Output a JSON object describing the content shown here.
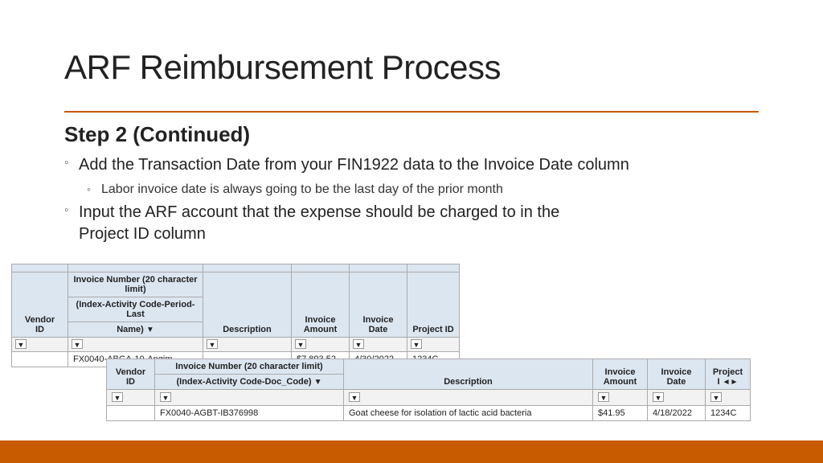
{
  "slide": {
    "title": "ARF Reimbursement Process",
    "step_heading": "Step 2 (Continued)",
    "bullets": [
      {
        "text": "Add the Transaction Date from your FIN1922 data to the Invoice Date column",
        "sub_bullets": [
          "Labor invoice date is always going to be the last day of the prior month"
        ]
      },
      {
        "text": "Input the ARF account that the expense should be charged to in the Project ID column",
        "sub_bullets": []
      }
    ]
  },
  "table1": {
    "headers": {
      "vendor_id": "Vendor ID",
      "invoice_number_line1": "Invoice Number (20 character",
      "invoice_number_line2": "limit)",
      "invoice_number_line3": "(Index-Activity Code-Period-Last",
      "invoice_number_line4": "Name)",
      "description": "Description",
      "invoice_amount": "Invoice Amount",
      "invoice_date": "Invoice Date",
      "project_id": "Project ID"
    },
    "row": {
      "vendor_id": "",
      "invoice_number": "FX0040-ABGA-10-Angim",
      "description": "",
      "invoice_amount": "$7,893.52",
      "invoice_date": "4/30/2022",
      "project_id": "1234C"
    }
  },
  "table2": {
    "headers": {
      "vendor_id": "Vendor ID",
      "invoice_number_line1": "Invoice Number (20 character limit)",
      "invoice_number_line2": "(Index-Activity Code-Doc_Code)",
      "description": "Description",
      "invoice_amount": "Invoice Amount",
      "invoice_date": "Invoice Date",
      "project_id": "Project I..."
    },
    "row": {
      "vendor_id": "",
      "invoice_number": "FX0040-AGBT-IB376998",
      "description": "Goat cheese for isolation of lactic acid bacteria",
      "invoice_amount": "$41.95",
      "invoice_date": "4/18/2022",
      "project_id": "1234C"
    }
  },
  "bottom_bar_color": "#c85a00"
}
